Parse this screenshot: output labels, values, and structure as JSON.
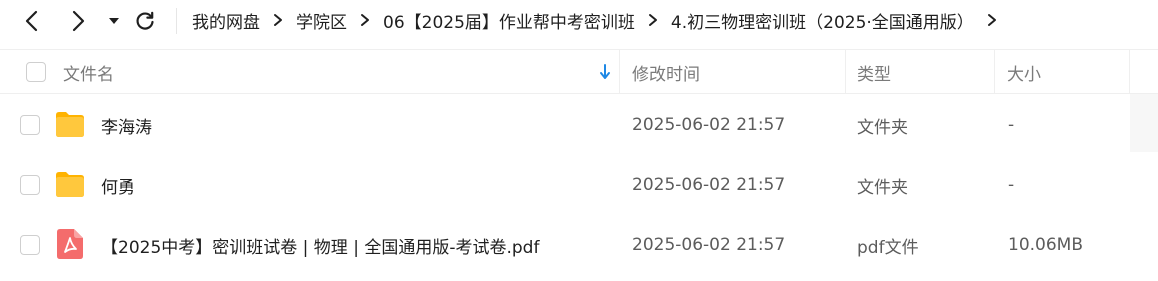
{
  "nav": {
    "back_icon": "chevron-left-icon",
    "forward_icon": "chevron-right-icon",
    "history_icon": "caret-down-icon",
    "refresh_icon": "refresh-icon"
  },
  "breadcrumb": {
    "items": [
      "我的网盘",
      "学院区",
      "06【2025届】作业帮中考密训班",
      "4.初三物理密训班（2025·全国通用版）"
    ],
    "separator_icon": "chevron-right-icon"
  },
  "table": {
    "columns": {
      "name": "文件名",
      "modified": "修改时间",
      "type": "类型",
      "size": "大小"
    },
    "sort_icon": "sort-down-arrow-icon",
    "rows": [
      {
        "icon": "folder-icon",
        "name": "李海涛",
        "modified": "2025-06-02 21:57",
        "type": "文件夹",
        "size": "-"
      },
      {
        "icon": "folder-icon",
        "name": "何勇",
        "modified": "2025-06-02 21:57",
        "type": "文件夹",
        "size": "-"
      },
      {
        "icon": "pdf-icon",
        "name": "【2025中考】密训班试卷 | 物理 | 全国通用版-考试卷.pdf",
        "modified": "2025-06-02 21:57",
        "type": "pdf文件",
        "size": "10.06MB"
      }
    ]
  },
  "colors": {
    "accent": "#1e88e5",
    "folder": "#ffc83d",
    "pdf": "#f46c6c",
    "border": "#efefef",
    "muted_text": "#7a7a7a"
  }
}
